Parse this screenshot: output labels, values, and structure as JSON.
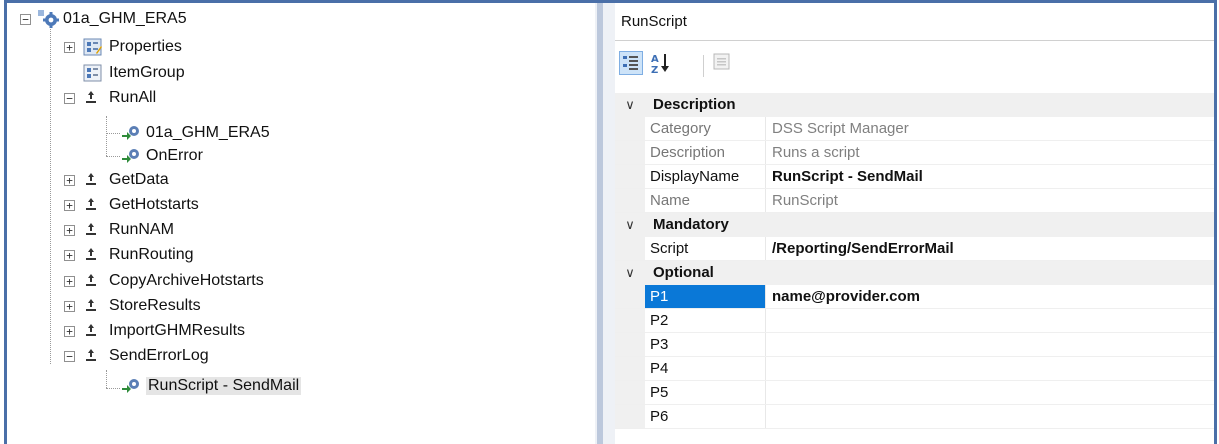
{
  "tree": {
    "root": {
      "label": "01a_GHM_ERA5",
      "expander": "−"
    },
    "nodes": [
      {
        "label": "Properties",
        "expander": "+"
      },
      {
        "label": "ItemGroup"
      },
      {
        "label": "RunAll",
        "expander": "−"
      },
      {
        "label": "01a_GHM_ERA5"
      },
      {
        "label": "OnError"
      },
      {
        "label": "GetData",
        "expander": "+"
      },
      {
        "label": "GetHotstarts",
        "expander": "+"
      },
      {
        "label": "RunNAM",
        "expander": "+"
      },
      {
        "label": "RunRouting",
        "expander": "+"
      },
      {
        "label": "CopyArchiveHotstarts",
        "expander": "+"
      },
      {
        "label": "StoreResults",
        "expander": "+"
      },
      {
        "label": "ImportGHMResults",
        "expander": "+"
      },
      {
        "label": "SendErrorLog",
        "expander": "−"
      },
      {
        "label": "RunScript - SendMail"
      }
    ]
  },
  "property_grid": {
    "title": "RunScript",
    "toolbar": {
      "categorized_icon": "categorized-icon",
      "alphabetical_icon": "sort-az-icon",
      "property_pages_icon": "property-pages-icon"
    },
    "categories": {
      "description": {
        "label": "Description",
        "chevron": "∨"
      },
      "mandatory": {
        "label": "Mandatory",
        "chevron": "∨"
      },
      "optional": {
        "label": "Optional",
        "chevron": "∨"
      }
    },
    "rows": {
      "category": {
        "name": "Category",
        "value": "DSS Script Manager"
      },
      "description": {
        "name": "Description",
        "value": "Runs a script"
      },
      "display_name": {
        "name": "DisplayName",
        "value": "RunScript - SendMail"
      },
      "name": {
        "name": "Name",
        "value": "RunScript"
      },
      "script": {
        "name": "Script",
        "value": "/Reporting/SendErrorMail"
      },
      "p1": {
        "name": "P1",
        "value": "name@provider.com"
      },
      "p2": {
        "name": "P2",
        "value": ""
      },
      "p3": {
        "name": "P3",
        "value": ""
      },
      "p4": {
        "name": "P4",
        "value": ""
      },
      "p5": {
        "name": "P5",
        "value": ""
      },
      "p6": {
        "name": "P6",
        "value": ""
      }
    }
  },
  "colors": {
    "window_border": "#4a6fa8",
    "selection": "#0a78d7",
    "category_background": "#f0f0f0"
  }
}
